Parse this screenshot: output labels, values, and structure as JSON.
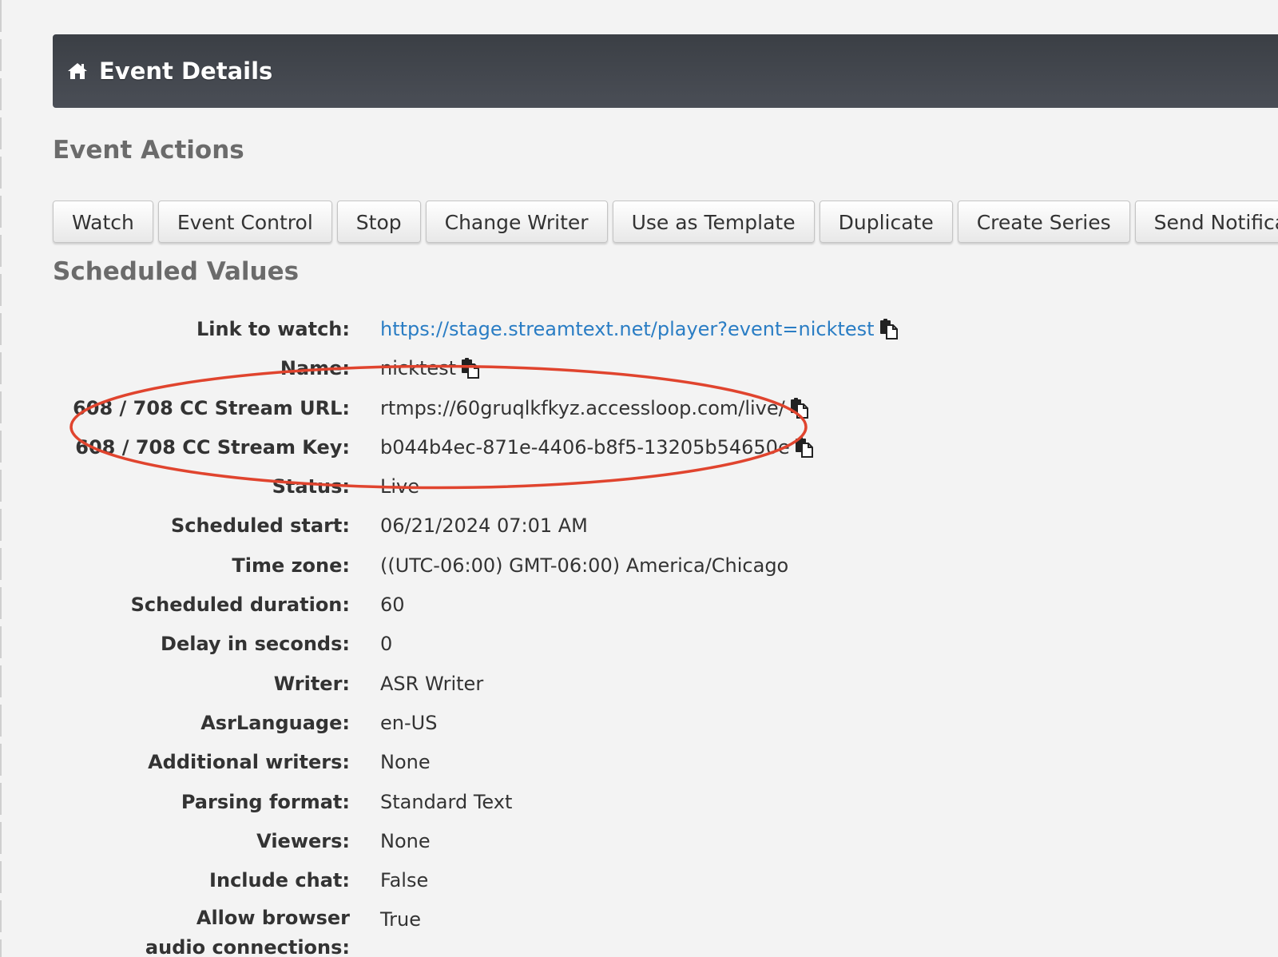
{
  "header": {
    "title": "Event Details",
    "icon": "home-icon",
    "background_color": "#42464d"
  },
  "actions": {
    "heading": "Event Actions",
    "buttons": [
      {
        "label": "Watch"
      },
      {
        "label": "Event Control"
      },
      {
        "label": "Stop"
      },
      {
        "label": "Change Writer"
      },
      {
        "label": "Use as Template"
      },
      {
        "label": "Duplicate"
      },
      {
        "label": "Create Series"
      },
      {
        "label": "Send Notification"
      }
    ]
  },
  "scheduled": {
    "heading": "Scheduled Values",
    "rows": [
      {
        "label": "Link to watch:",
        "value": "https://stage.streamtext.net/player?event=nicktest",
        "is_link": true,
        "copy_icon": true
      },
      {
        "label": "Name:",
        "value": "nicktest",
        "copy_icon": true
      },
      {
        "label": "608 / 708 CC Stream URL:",
        "value": "rtmps://60gruqlkfkyz.accessloop.com/live/",
        "copy_icon": true
      },
      {
        "label": "608 / 708 CC Stream Key:",
        "value": "b044b4ec-871e-4406-b8f5-13205b54650e",
        "copy_icon": true
      },
      {
        "label": "Status:",
        "value": "Live"
      },
      {
        "label": "Scheduled start:",
        "value": "06/21/2024 07:01 AM"
      },
      {
        "label": "Time zone:",
        "value": "((UTC-06:00) GMT-06:00) America/Chicago"
      },
      {
        "label": "Scheduled duration:",
        "value": "60"
      },
      {
        "label": "Delay in seconds:",
        "value": "0"
      },
      {
        "label": "Writer:",
        "value": "ASR Writer"
      },
      {
        "label": "AsrLanguage:",
        "value": "en-US"
      },
      {
        "label": "Additional writers:",
        "value": "None"
      },
      {
        "label": "Parsing format:",
        "value": "Standard Text"
      },
      {
        "label": "Viewers:",
        "value": "None"
      },
      {
        "label": "Include chat:",
        "value": "False"
      },
      {
        "label": "Allow browser audio connections:",
        "value": "True"
      }
    ]
  },
  "colors": {
    "link": "#2a7dc4",
    "annotation_ellipse": "#e0442e",
    "heading": "#6b6b6b"
  }
}
